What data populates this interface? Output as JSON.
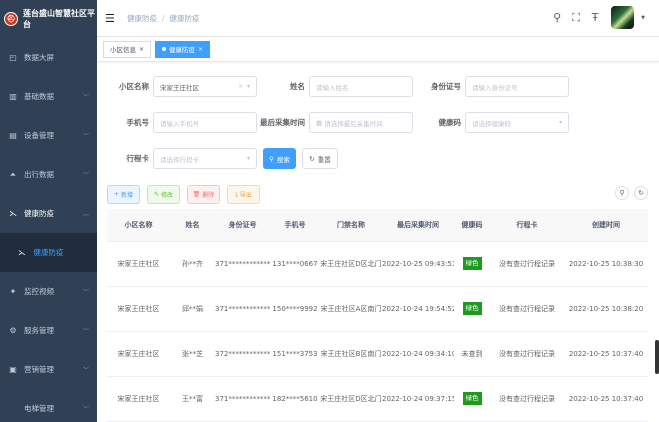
{
  "sidebar": {
    "brand": "莲台盛山智慧社区平台",
    "logo_glyph": "⛑",
    "items": [
      {
        "label": "数据大屏",
        "icon": "monitor-icon",
        "glyph": "◰"
      },
      {
        "label": "基础数据",
        "icon": "chart-icon",
        "glyph": "▥"
      },
      {
        "label": "设备管理",
        "icon": "device-icon",
        "glyph": "▤"
      },
      {
        "label": "出行数据",
        "icon": "car-icon",
        "glyph": "⏶"
      },
      {
        "label": "健康防疫",
        "icon": "health-icon",
        "glyph": "⋋",
        "open": true
      },
      {
        "label": "监控视频",
        "icon": "camera-icon",
        "glyph": "✦"
      },
      {
        "label": "服务管理",
        "icon": "service-icon",
        "glyph": "⚙"
      },
      {
        "label": "营销管理",
        "icon": "market-icon",
        "glyph": "▣"
      },
      {
        "label": "电梯管理",
        "icon": "elevator-icon",
        "glyph": ""
      }
    ],
    "sub_item": {
      "label": "健康防疫",
      "icon": "health-icon",
      "glyph": "⋋"
    }
  },
  "topbar": {
    "breadcrumb": [
      "健康防疫",
      "健康防疫"
    ],
    "separator": "/"
  },
  "tags": [
    {
      "label": "小区信息",
      "active": false
    },
    {
      "label": "健康防疫",
      "active": true
    }
  ],
  "filters": {
    "community": {
      "label": "小区名称",
      "value": "宋家王庄社区"
    },
    "name": {
      "label": "姓名",
      "placeholder": "请输入姓名"
    },
    "idcard": {
      "label": "身份证号",
      "placeholder": "请输入身份证号"
    },
    "phone": {
      "label": "手机号",
      "placeholder": "请输入手机号"
    },
    "last_time": {
      "label": "最后采集时间",
      "placeholder": "请选择最后采集时间"
    },
    "health_code": {
      "label": "健康码",
      "placeholder": "请选择健康码"
    },
    "trip_card": {
      "label": "行程卡",
      "placeholder": "请选择行程卡"
    },
    "search_label": "搜索",
    "reset_label": "重置"
  },
  "actions": {
    "add": "新增",
    "edit": "修改",
    "delete": "删除",
    "export": "导出"
  },
  "table": {
    "columns": [
      "小区名称",
      "姓名",
      "身份证号",
      "手机号",
      "门禁名称",
      "最后采集时间",
      "健康码",
      "行程卡",
      "创建时间"
    ],
    "rows": [
      {
        "community": "宋家王庄社区",
        "name": "孙**齐",
        "idcard": "371************...",
        "phone": "131****0667",
        "gate": "宋王庄社区D区北门",
        "last_time": "2022-10-25 09:43:51",
        "health": "绿色",
        "health_color": "#1e9a1e",
        "trip": "没有查过行程记录",
        "created": "2022-10-25 10:38:30"
      },
      {
        "community": "宋家王庄社区",
        "name": "邱**娟",
        "idcard": "371************...",
        "phone": "150****9992",
        "gate": "宋王庄社区A区南门",
        "last_time": "2022-10-24 19:54:52",
        "health": "绿色",
        "health_color": "#1e9a1e",
        "trip": "没有查过行程记录",
        "created": "2022-10-25 10:38:20"
      },
      {
        "community": "宋家王庄社区",
        "name": "张**芝",
        "idcard": "372************...",
        "phone": "151****3753",
        "gate": "宋王庄社区B区南门",
        "last_time": "2022-10-24 09:34:10",
        "health": "未查到",
        "health_color": "",
        "trip": "没有查过行程记录",
        "created": "2022-10-25 10:37:40"
      },
      {
        "community": "宋家王庄社区",
        "name": "王**富",
        "idcard": "371************...",
        "phone": "182****5610",
        "gate": "宋王庄社区D区北门",
        "last_time": "2022-10-24 09:37:15",
        "health": "绿色",
        "health_color": "#1e9a1e",
        "trip": "没有查过行程记录",
        "created": "2022-10-25 10:37:40"
      }
    ]
  }
}
